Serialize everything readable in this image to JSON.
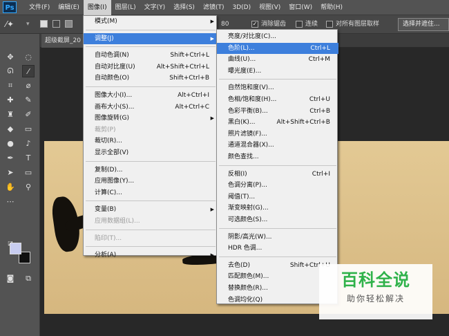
{
  "app": {
    "logo": "Ps"
  },
  "menubar": [
    {
      "label": "文件(F)"
    },
    {
      "label": "编辑(E)"
    },
    {
      "label": "图像(I)",
      "active": true
    },
    {
      "label": "图层(L)"
    },
    {
      "label": "文字(Y)"
    },
    {
      "label": "选择(S)"
    },
    {
      "label": "滤镜(T)"
    },
    {
      "label": "3D(D)"
    },
    {
      "label": "视图(V)"
    },
    {
      "label": "窗口(W)"
    },
    {
      "label": "帮助(H)"
    }
  ],
  "options": {
    "tolerance_value": "80",
    "antialias_label": "消除锯齿",
    "antialias_checked": true,
    "contiguous_label": "连续",
    "contiguous_checked": false,
    "sample_all_label": "对所有图层取样",
    "sample_all_checked": false,
    "select_subject_label": "选择并遮住..."
  },
  "document": {
    "tab_title": "超级截屏_20"
  },
  "image_menu": {
    "items": [
      {
        "label": "模式(M)",
        "submenu": true
      },
      {
        "separator": true
      },
      {
        "label": "调整(J)",
        "submenu": true,
        "highlighted": true
      },
      {
        "separator": true
      },
      {
        "label": "自动色调(N)",
        "shortcut": "Shift+Ctrl+L"
      },
      {
        "label": "自动对比度(U)",
        "shortcut": "Alt+Shift+Ctrl+L"
      },
      {
        "label": "自动颜色(O)",
        "shortcut": "Shift+Ctrl+B"
      },
      {
        "separator": true
      },
      {
        "label": "图像大小(I)...",
        "shortcut": "Alt+Ctrl+I"
      },
      {
        "label": "画布大小(S)...",
        "shortcut": "Alt+Ctrl+C"
      },
      {
        "label": "图像旋转(G)",
        "submenu": true
      },
      {
        "label": "裁剪(P)",
        "disabled": true
      },
      {
        "label": "裁切(R)..."
      },
      {
        "label": "显示全部(V)"
      },
      {
        "separator": true
      },
      {
        "label": "复制(D)..."
      },
      {
        "label": "应用图像(Y)..."
      },
      {
        "label": "计算(C)..."
      },
      {
        "separator": true
      },
      {
        "label": "变量(B)",
        "submenu": true
      },
      {
        "label": "应用数据组(L)...",
        "disabled": true
      },
      {
        "separator": true
      },
      {
        "label": "陷印(T)...",
        "disabled": true
      },
      {
        "separator": true
      },
      {
        "label": "分析(A)",
        "submenu": true
      }
    ]
  },
  "adjust_menu": {
    "items": [
      {
        "label": "亮度/对比度(C)..."
      },
      {
        "label": "色阶(L)...",
        "shortcut": "Ctrl+L",
        "highlighted": true
      },
      {
        "label": "曲线(U)...",
        "shortcut": "Ctrl+M"
      },
      {
        "label": "曝光度(E)..."
      },
      {
        "separator": true
      },
      {
        "label": "自然饱和度(V)..."
      },
      {
        "label": "色相/饱和度(H)...",
        "shortcut": "Ctrl+U"
      },
      {
        "label": "色彩平衡(B)...",
        "shortcut": "Ctrl+B"
      },
      {
        "label": "黑白(K)...",
        "shortcut": "Alt+Shift+Ctrl+B"
      },
      {
        "label": "照片滤镜(F)..."
      },
      {
        "label": "通道混合器(X)..."
      },
      {
        "label": "颜色查找..."
      },
      {
        "separator": true
      },
      {
        "label": "反相(I)",
        "shortcut": "Ctrl+I"
      },
      {
        "label": "色调分离(P)..."
      },
      {
        "label": "阈值(T)..."
      },
      {
        "label": "渐变映射(G)..."
      },
      {
        "label": "可选颜色(S)..."
      },
      {
        "separator": true
      },
      {
        "label": "阴影/高光(W)..."
      },
      {
        "label": "HDR 色调..."
      },
      {
        "separator": true
      },
      {
        "label": "去色(D)",
        "shortcut": "Shift+Ctrl+U"
      },
      {
        "label": "匹配颜色(M)..."
      },
      {
        "label": "替换颜色(R)..."
      },
      {
        "label": "色调均化(Q)"
      }
    ]
  },
  "tools": [
    "move-icon",
    "marquee-icon",
    "lasso-icon",
    "magic-wand-icon",
    "crop-icon",
    "eyedropper-icon",
    "healing-brush-icon",
    "brush-icon",
    "clone-stamp-icon",
    "history-brush-icon",
    "eraser-icon",
    "gradient-icon",
    "blur-icon",
    "dodge-icon",
    "pen-icon",
    "type-icon",
    "path-selection-icon",
    "rectangle-icon",
    "hand-icon",
    "zoom-icon",
    "more-tools-icon"
  ],
  "colors": {
    "foreground": "#c8cdf0",
    "background": "#101010",
    "menu_highlight": "#3d7fdc",
    "menubar_bg": "#535353",
    "paper": "#dcc08a"
  },
  "watermark": {
    "title": "百科全说",
    "subtitle": "助你轻松解决"
  }
}
